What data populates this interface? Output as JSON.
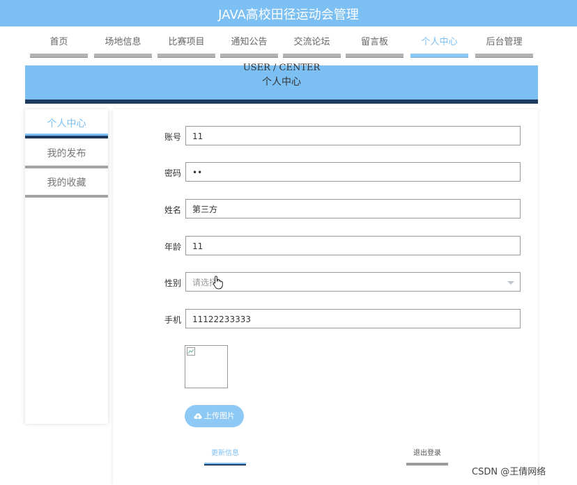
{
  "app": {
    "title": "JAVA高校田径运动会管理"
  },
  "nav": {
    "items": [
      {
        "label": "首页"
      },
      {
        "label": "场地信息"
      },
      {
        "label": "比赛项目"
      },
      {
        "label": "通知公告"
      },
      {
        "label": "交流论坛"
      },
      {
        "label": "留言板"
      },
      {
        "label": "个人中心",
        "active": true
      },
      {
        "label": "后台管理"
      }
    ]
  },
  "banner": {
    "en": "USER / CENTER",
    "cn": "个人中心"
  },
  "sidebar": {
    "items": [
      {
        "label": "个人中心",
        "active": true
      },
      {
        "label": "我的发布"
      },
      {
        "label": "我的收藏"
      }
    ]
  },
  "form": {
    "account": {
      "label": "账号",
      "value": "11"
    },
    "password": {
      "label": "密码",
      "value": "••"
    },
    "name": {
      "label": "姓名",
      "value": "第三方"
    },
    "age": {
      "label": "年龄",
      "value": "11"
    },
    "gender": {
      "label": "性别",
      "placeholder": "请选择"
    },
    "phone": {
      "label": "手机",
      "value": "11122233333"
    }
  },
  "upload": {
    "label": "上传图片",
    "icon": "cloud-upload-icon"
  },
  "actions": {
    "update_label": "更新信息",
    "logout_label": "退出登录"
  },
  "watermark": "CSDN @王倩网络",
  "colors": {
    "accent": "#7cbff3",
    "dark": "#1e3a5f"
  }
}
